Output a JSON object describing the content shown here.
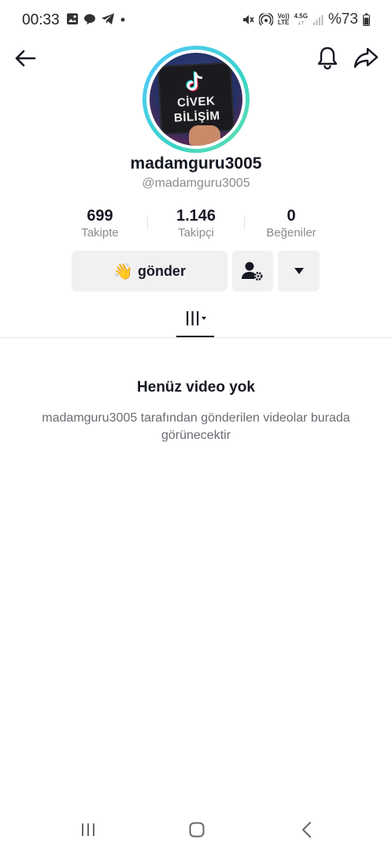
{
  "status_bar": {
    "time": "00:33",
    "battery_text": "%73",
    "volte_top": "Vo))",
    "volte_bottom": "LTE",
    "network_top": "4.5G",
    "network_bottom": "↓↑"
  },
  "profile": {
    "avatar_text_line1": "CİVEK",
    "avatar_text_line2": "BİLİŞİM",
    "username": "madamguru3005",
    "handle": "@madamguru3005"
  },
  "stats": [
    {
      "value": "699",
      "label": "Takipte"
    },
    {
      "value": "1.146",
      "label": "Takipçi"
    },
    {
      "value": "0",
      "label": "Beğeniler"
    }
  ],
  "actions": {
    "send_emoji": "👋",
    "send_label": "gönder"
  },
  "empty_state": {
    "title": "Henüz video yok",
    "description": "madamguru3005 tarafından gönderilen videolar burada görünecektir"
  },
  "colors": {
    "accent_ring": "#54c9ff",
    "button_bg": "#f1f1f2",
    "text_primary": "#161823",
    "text_secondary": "#8a8b91"
  }
}
